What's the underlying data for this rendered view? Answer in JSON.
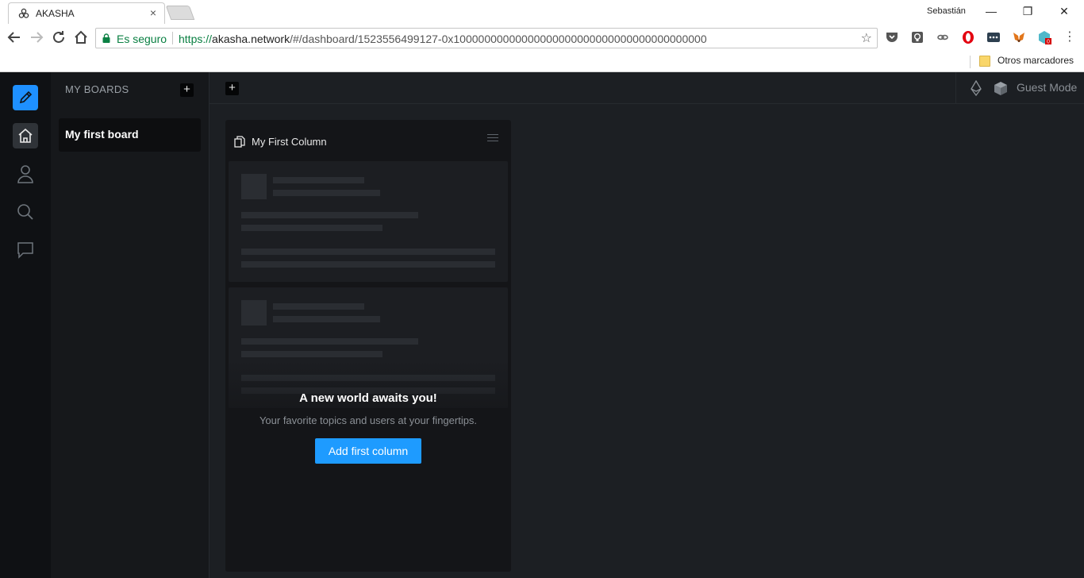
{
  "browser": {
    "tab_title": "AKASHA",
    "tab_close": "×",
    "profile_name": "Sebastián",
    "window_controls": {
      "minimize": "—",
      "restore": "❐",
      "close": "✕"
    },
    "secure_label": "Es seguro",
    "url_scheme": "https://",
    "url_host": "akasha.network",
    "url_path": "/#/dashboard/1523556499127-0x10000000000000000000000000000000000000000",
    "extension_badge": "0",
    "bookmarks_folder": "Otros marcadores"
  },
  "sidebar": {
    "boards_title": "MY BOARDS",
    "add_symbol": "+",
    "boards": [
      {
        "label": "My first board"
      }
    ]
  },
  "topbar": {
    "add_symbol": "+",
    "guest_mode": "Guest Mode"
  },
  "column": {
    "title": "My First Column",
    "empty_title": "A new world awaits you!",
    "empty_subtitle": "Your favorite topics and users at your fingertips.",
    "add_button": "Add first column"
  },
  "colors": {
    "accent": "#1e9bff",
    "background": "#1c1f23",
    "rail": "#0f1114",
    "secure_green": "#0b8043"
  },
  "icons": {
    "rail": [
      "pencil-icon",
      "home-icon",
      "user-icon",
      "search-icon",
      "chat-icon"
    ],
    "topbar": [
      "ethereum-icon",
      "cube-icon"
    ]
  }
}
